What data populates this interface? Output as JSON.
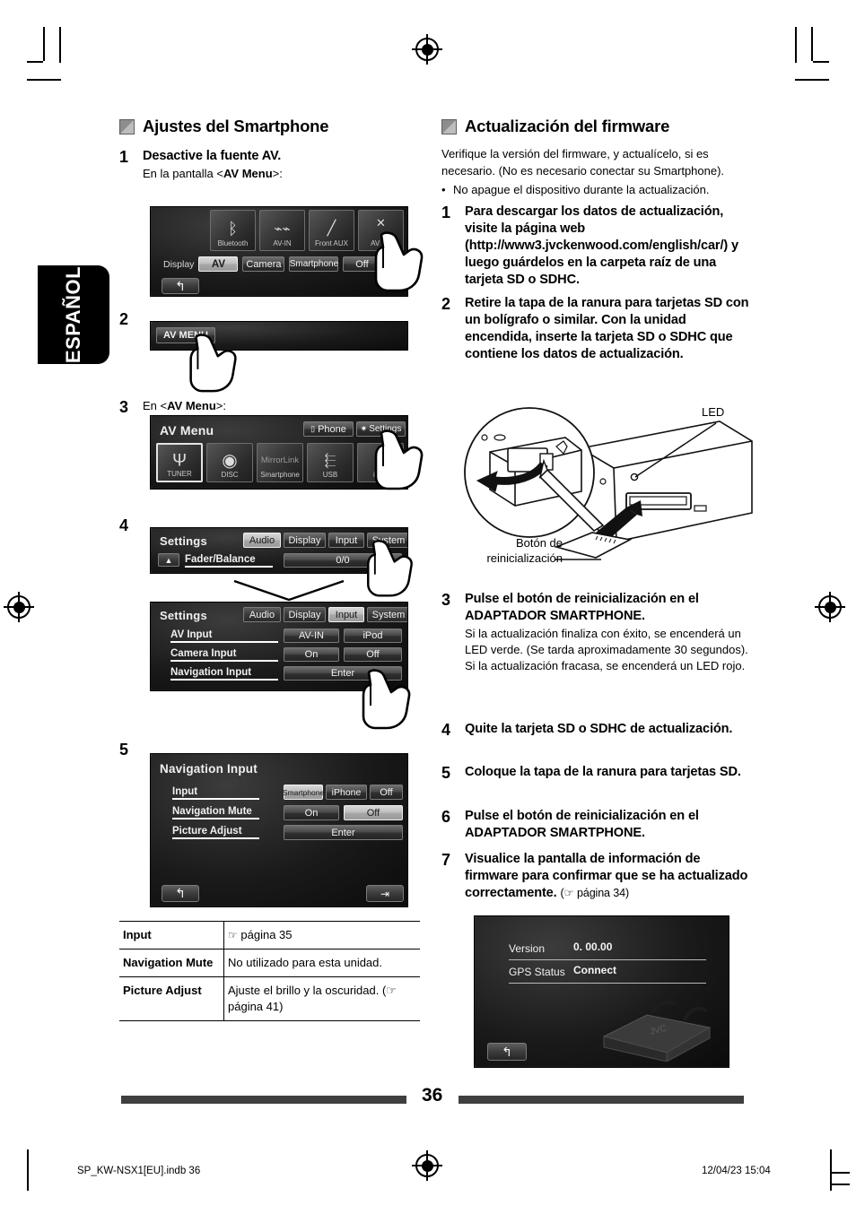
{
  "page": {
    "number": "36",
    "language_tab": "ESPAÑOL",
    "footer_file": "SP_KW-NSX1[EU].indb   36",
    "footer_date": "12/04/23   15:04"
  },
  "left_column": {
    "heading": "Ajustes del Smartphone",
    "steps": [
      {
        "num": "1",
        "title": "Desactive la fuente AV.",
        "sub_prefix": "En la pantalla <",
        "sub_bold": "AV Menu",
        "sub_suffix": ">:"
      },
      {
        "num": "2",
        "title": ""
      },
      {
        "num": "3",
        "sub_prefix": "En <",
        "sub_bold": "AV Menu",
        "sub_suffix": ">:"
      },
      {
        "num": "4",
        "title": ""
      },
      {
        "num": "5",
        "title": ""
      }
    ],
    "shot_av_source": {
      "tiles": [
        {
          "label": "Bluetooth",
          "glyph": "bluetooth-icon"
        },
        {
          "label": "AV-IN",
          "glyph": "av-in-icon"
        },
        {
          "label": "Front AUX",
          "glyph": "aux-plug-icon"
        },
        {
          "label": "AV Off",
          "glyph": "close-x-icon"
        }
      ],
      "display_label": "Display",
      "display_buttons": [
        {
          "label": "AV",
          "selected": true
        },
        {
          "label": "Camera",
          "selected": false
        },
        {
          "label": "Smartphone",
          "selected": false
        },
        {
          "label": "Off",
          "selected": false
        }
      ],
      "back_glyph": "back-arrow-icon"
    },
    "shot_av_menu_bar": {
      "button": "AV MENU"
    },
    "shot_av_menu": {
      "title": "AV Menu",
      "top_buttons": [
        {
          "label": "Phone",
          "glyph": "phone-icon"
        },
        {
          "label": "Settings",
          "glyph": "gear-icon"
        }
      ],
      "tiles": [
        {
          "label": "TUNER",
          "glyph": "antenna-icon",
          "selected": true
        },
        {
          "label": "DISC",
          "glyph": "disc-icon",
          "selected": false
        },
        {
          "label": "Smartphone",
          "glyph": "mirrorlink-icon",
          "top_label": "MirrorLink",
          "selected": false
        },
        {
          "label": "USB",
          "glyph": "usb-icon",
          "selected": false
        },
        {
          "label": "iPod",
          "glyph": "ipod-icon",
          "selected": false
        }
      ]
    },
    "shot_settings_audio": {
      "title": "Settings",
      "tabs": [
        {
          "label": "Audio",
          "selected": true
        },
        {
          "label": "Display",
          "selected": false
        },
        {
          "label": "Input",
          "selected": false
        },
        {
          "label": "System",
          "selected": false
        }
      ],
      "row_label": "Fader/Balance",
      "row_value": "0/0",
      "up_glyph": "up-triangle-icon"
    },
    "shot_settings_input": {
      "title": "Settings",
      "tabs": [
        {
          "label": "Audio",
          "selected": false
        },
        {
          "label": "Display",
          "selected": false
        },
        {
          "label": "Input",
          "selected": true
        },
        {
          "label": "System",
          "selected": false
        }
      ],
      "rows": [
        {
          "label": "AV Input",
          "buttons": [
            {
              "label": "AV-IN",
              "selected": false
            },
            {
              "label": "iPod",
              "selected": false
            }
          ]
        },
        {
          "label": "Camera Input",
          "buttons": [
            {
              "label": "On",
              "selected": false
            },
            {
              "label": "Off",
              "selected": false
            }
          ]
        },
        {
          "label": "Navigation Input",
          "buttons": [
            {
              "label": "Enter",
              "selected": false,
              "wide": true
            }
          ]
        }
      ]
    },
    "shot_navigation_input": {
      "title": "Navigation Input",
      "rows": [
        {
          "label": "Input",
          "buttons": [
            {
              "label": "Smartphone",
              "selected": true
            },
            {
              "label": "iPhone",
              "selected": false
            },
            {
              "label": "Off",
              "selected": false
            }
          ]
        },
        {
          "label": "Navigation Mute",
          "buttons": [
            {
              "label": "On",
              "selected": false
            },
            {
              "label": "Off",
              "selected": true
            }
          ]
        },
        {
          "label": "Picture Adjust",
          "buttons": [
            {
              "label": "Enter",
              "selected": false,
              "wide": true
            }
          ]
        }
      ],
      "back_glyph": "back-arrow-icon",
      "exit_glyph": "exit-arrow-icon"
    },
    "ref_table": [
      {
        "key": "Input",
        "value_icon": "pointing-hand-icon",
        "value": "página 35"
      },
      {
        "key": "Navigation Mute",
        "value": "No utilizado para esta unidad."
      },
      {
        "key": "Picture Adjust",
        "value_icon": "pointing-hand-icon",
        "value": "Ajuste el brillo y la oscuridad. (☞ página 41)"
      }
    ]
  },
  "right_column": {
    "heading": "Actualización del firmware",
    "intro": "Verifique la versión del firmware, y actualícelo, si es necesario. (No es necesario conectar su Smartphone).",
    "bullet": "No apague el dispositivo durante la actualización.",
    "steps": [
      {
        "num": "1",
        "title": "Para descargar los datos de actualización, visite la página web (http://www3.jvckenwood.com/english/car/) y luego guárdelos en la carpeta raíz de una tarjeta SD o SDHC."
      },
      {
        "num": "2",
        "title": "Retire la tapa de la ranura para tarjetas SD con un bolígrafo o similar. Con la unidad encendida, inserte la tarjeta SD o SDHC que contiene los datos de actualización."
      },
      {
        "num": "3",
        "title": "Pulse el botón de reinicialización en el ADAPTADOR SMARTPHONE.",
        "body": "Si la actualización finaliza con éxito, se encenderá un LED verde. (Se tarda aproximadamente 30 segundos). Si la actualización fracasa, se encenderá un LED rojo."
      },
      {
        "num": "4",
        "title": "Quite la tarjeta SD o SDHC de actualización."
      },
      {
        "num": "5",
        "title": "Coloque la tapa de la ranura para tarjetas SD."
      },
      {
        "num": "6",
        "title": "Pulse el botón de reinicialización en el ADAPTADOR SMARTPHONE."
      },
      {
        "num": "7",
        "title": "Visualice la pantalla de información de firmware para confirmar que se ha actualizado correctamente.",
        "note": "(☞ página 34)"
      }
    ],
    "diagram": {
      "led_label": "LED",
      "reset_label_line1": "Botón de",
      "reset_label_line2": "reinicialización"
    },
    "shot_firmware_info": {
      "rows": [
        {
          "label": "Version",
          "value": "0. 00.00"
        },
        {
          "label": "GPS Status",
          "value": "Connect"
        }
      ],
      "device_logo": "JVC",
      "back_glyph": "back-arrow-icon"
    }
  }
}
